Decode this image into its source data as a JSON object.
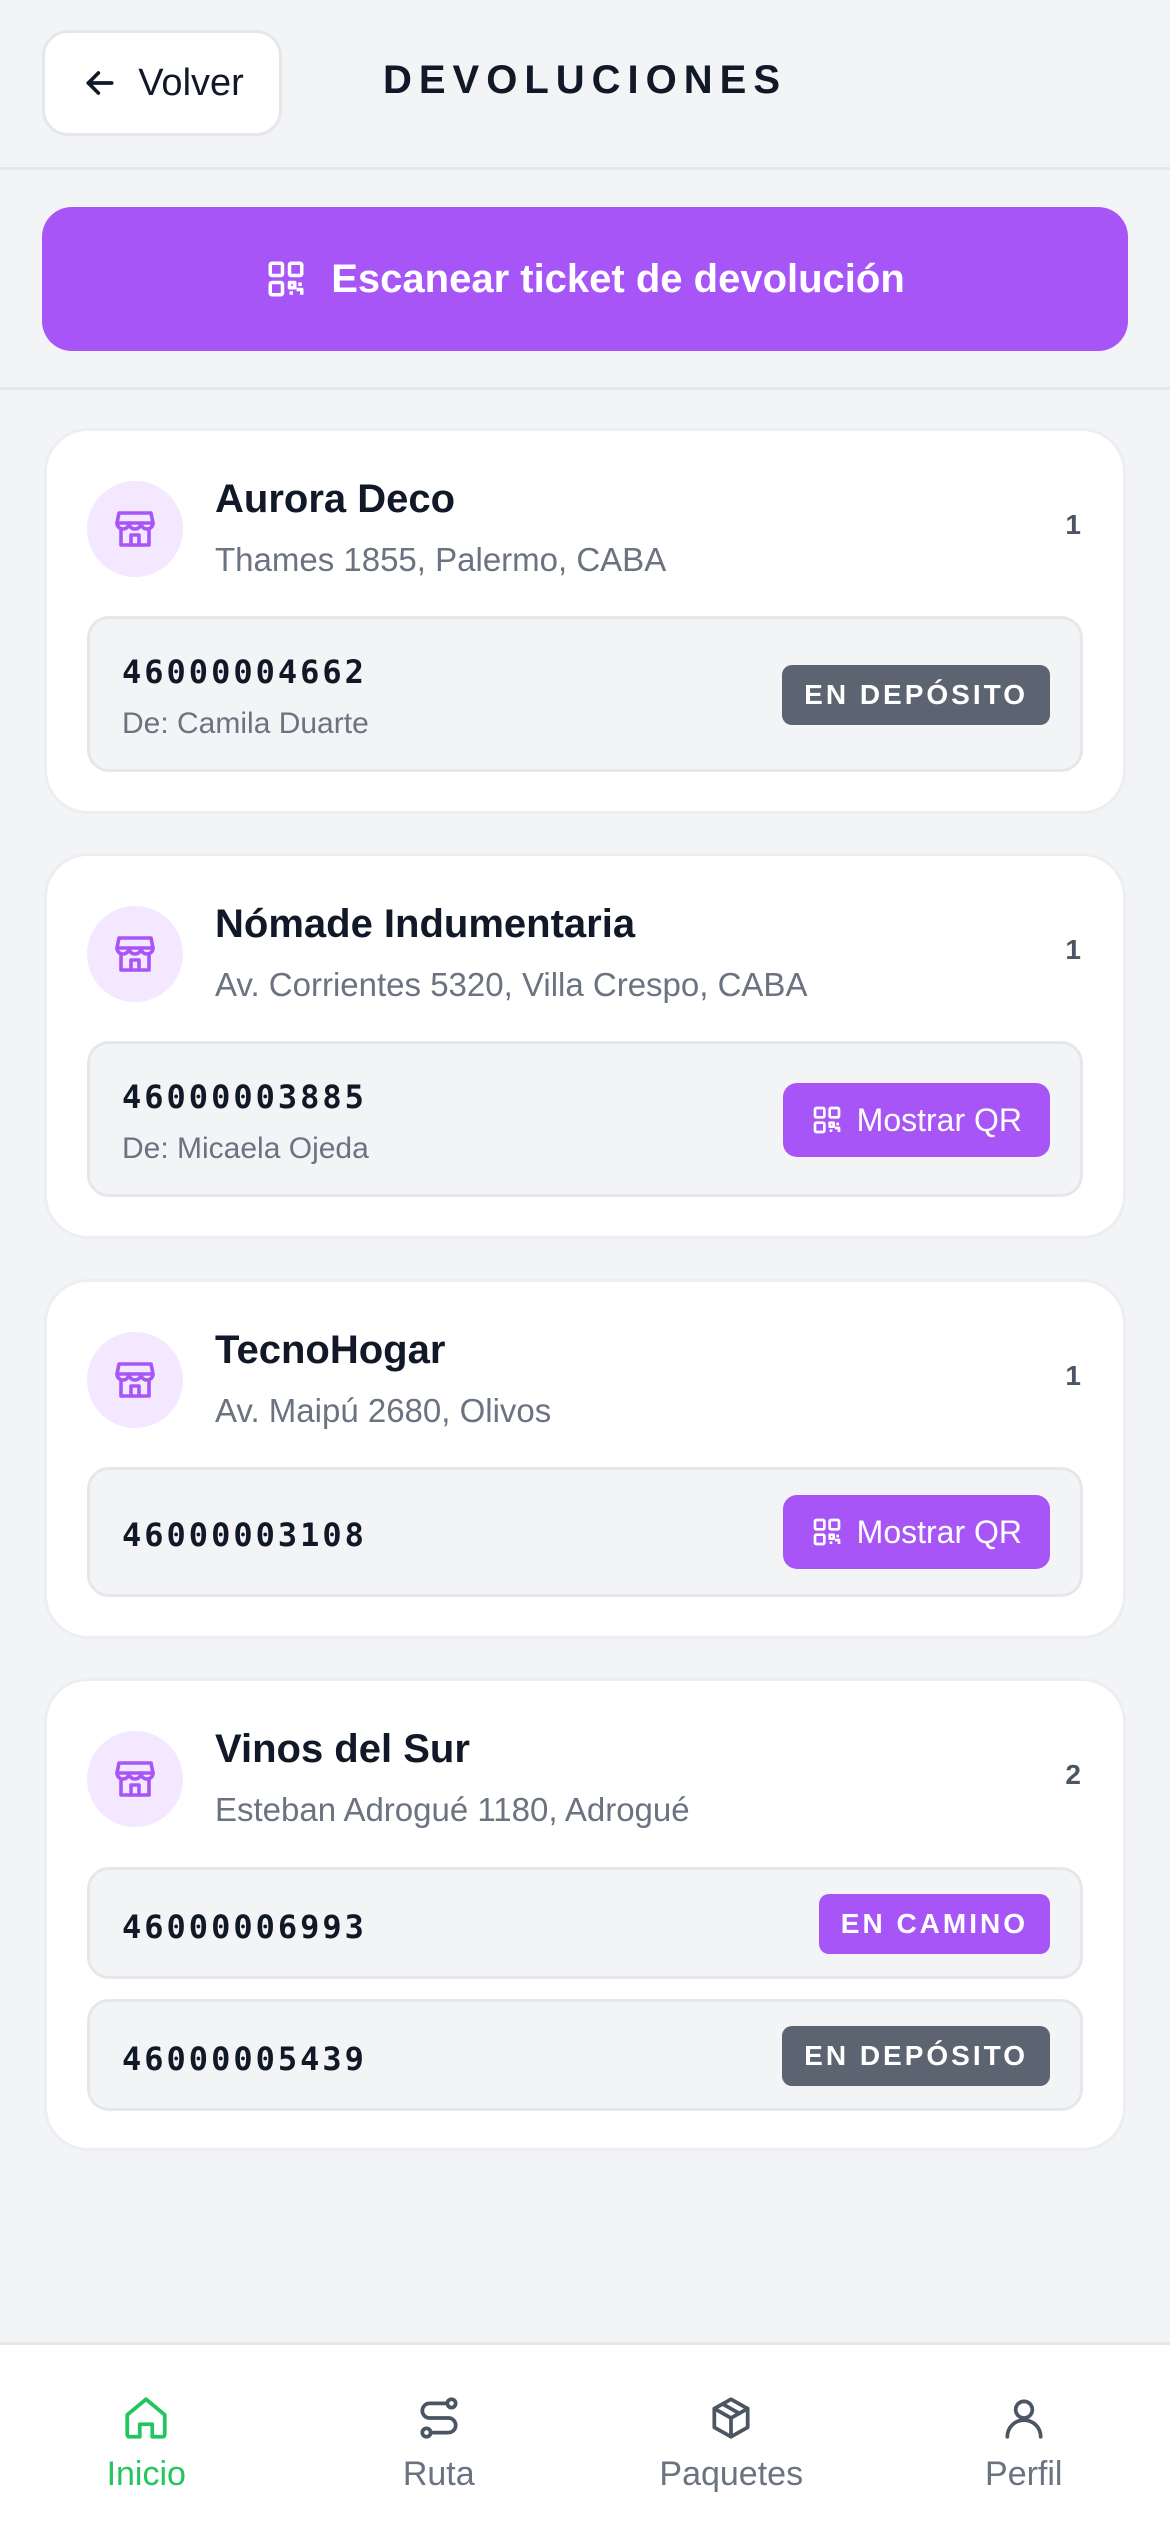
{
  "header": {
    "back_label": "Volver",
    "title": "DEVOLUCIONES"
  },
  "scan_button": {
    "label": "Escanear ticket de devolución"
  },
  "stores": [
    {
      "name": "Aurora Deco",
      "address": "Thames 1855, Palermo, CABA",
      "count": "1",
      "packages": [
        {
          "code": "46000004662",
          "from": "De: Camila Duarte",
          "status": "EN DEPÓSITO"
        }
      ]
    },
    {
      "name": "Nómade Indumentaria",
      "address": "Av. Corrientes 5320, Villa Crespo, CABA",
      "count": "1",
      "packages": [
        {
          "code": "46000003885",
          "from": "De: Micaela Ojeda",
          "action": "Mostrar QR"
        }
      ]
    },
    {
      "name": "TecnoHogar",
      "address": "Av. Maipú 2680, Olivos",
      "count": "1",
      "packages": [
        {
          "code": "46000003108",
          "action": "Mostrar QR"
        }
      ]
    },
    {
      "name": "Vinos del Sur",
      "address": "Esteban Adrogué 1180, Adrogué",
      "count": "2",
      "packages": [
        {
          "code": "46000006993",
          "status": "EN CAMINO"
        },
        {
          "code": "46000005439",
          "status": "EN DEPÓSITO"
        }
      ]
    }
  ],
  "bottom_nav": {
    "items": [
      {
        "label": "Inicio",
        "icon": "home-icon",
        "active": true
      },
      {
        "label": "Ruta",
        "icon": "route-icon"
      },
      {
        "label": "Paquetes",
        "icon": "package-icon"
      },
      {
        "label": "Perfil",
        "icon": "user-icon"
      }
    ]
  },
  "colors": {
    "accent": "#a855f7",
    "accent_light": "#f3e8ff",
    "active_nav": "#22c55e",
    "badge_gray": "#5b6470"
  }
}
